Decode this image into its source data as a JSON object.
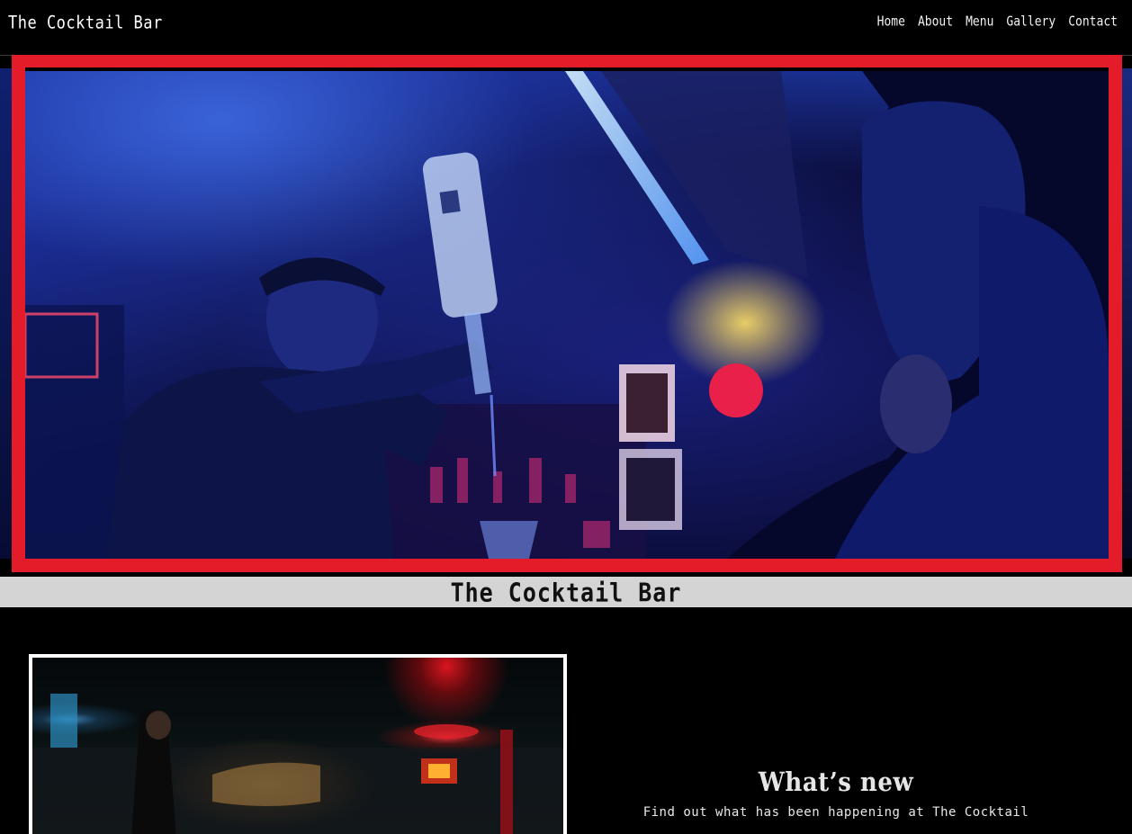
{
  "nav": {
    "brand": "The Cocktail Bar",
    "links": [
      "Home",
      "About",
      "Menu",
      "Gallery",
      "Contact"
    ]
  },
  "hero": {
    "frame_color": "#e41c2a",
    "image_alt": "bartender-pouring-drink-photo"
  },
  "title_band": {
    "text": "The Cocktail Bar",
    "background": "#d4d4d4"
  },
  "whats_new": {
    "title": "What’s new",
    "body": "Find out what has been happening at The Cocktail"
  }
}
